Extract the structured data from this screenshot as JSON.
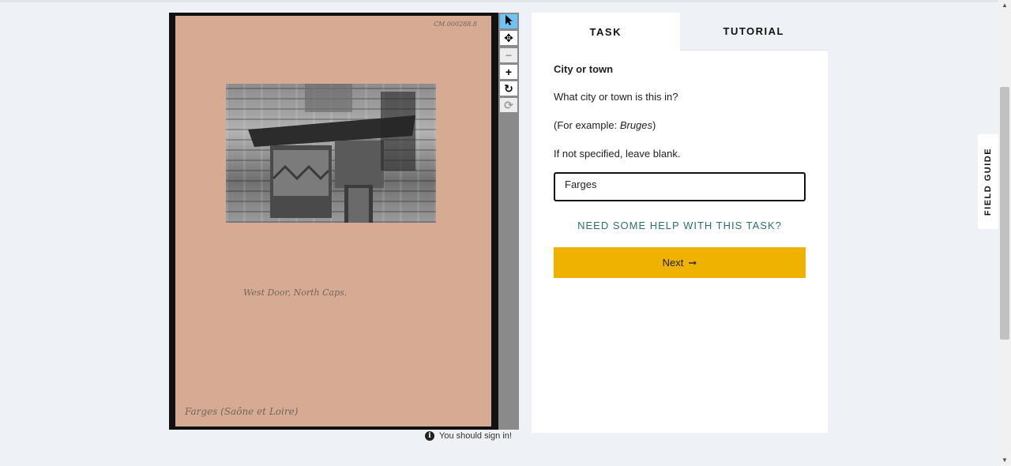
{
  "document": {
    "reference_number": "CM.000288.8",
    "caption_handwriting": "West Door, North Caps.",
    "location_handwriting": "Farges (Saône et Loire)"
  },
  "toolbar": {
    "select_icon": "cursor-arrow-icon",
    "pan_icon": "move-arrows-icon",
    "zoom_out_icon": "minus-icon",
    "zoom_in_icon": "plus-icon",
    "rotate_icon": "rotate-icon",
    "reset_icon": "refresh-icon"
  },
  "signin": {
    "text": "You should sign in!"
  },
  "tabs": [
    {
      "label": "TASK",
      "active": true
    },
    {
      "label": "TUTORIAL",
      "active": false
    }
  ],
  "task": {
    "title": "City or town",
    "question": "What city or town is this in?",
    "example_prefix": "(For example: ",
    "example_value": "Bruges",
    "example_suffix": ")",
    "instruction": "If not specified, leave blank.",
    "answer_value": "Farges",
    "help_link": "NEED SOME HELP WITH THIS TASK?",
    "next_label": "Next",
    "next_arrow": "➞"
  },
  "field_guide": {
    "label": "FIELD GUIDE"
  },
  "colors": {
    "next_button": "#f0b200",
    "help_link": "#2b6f78",
    "active_tool": "#6ec3f5",
    "paper": "#d6aa93"
  }
}
